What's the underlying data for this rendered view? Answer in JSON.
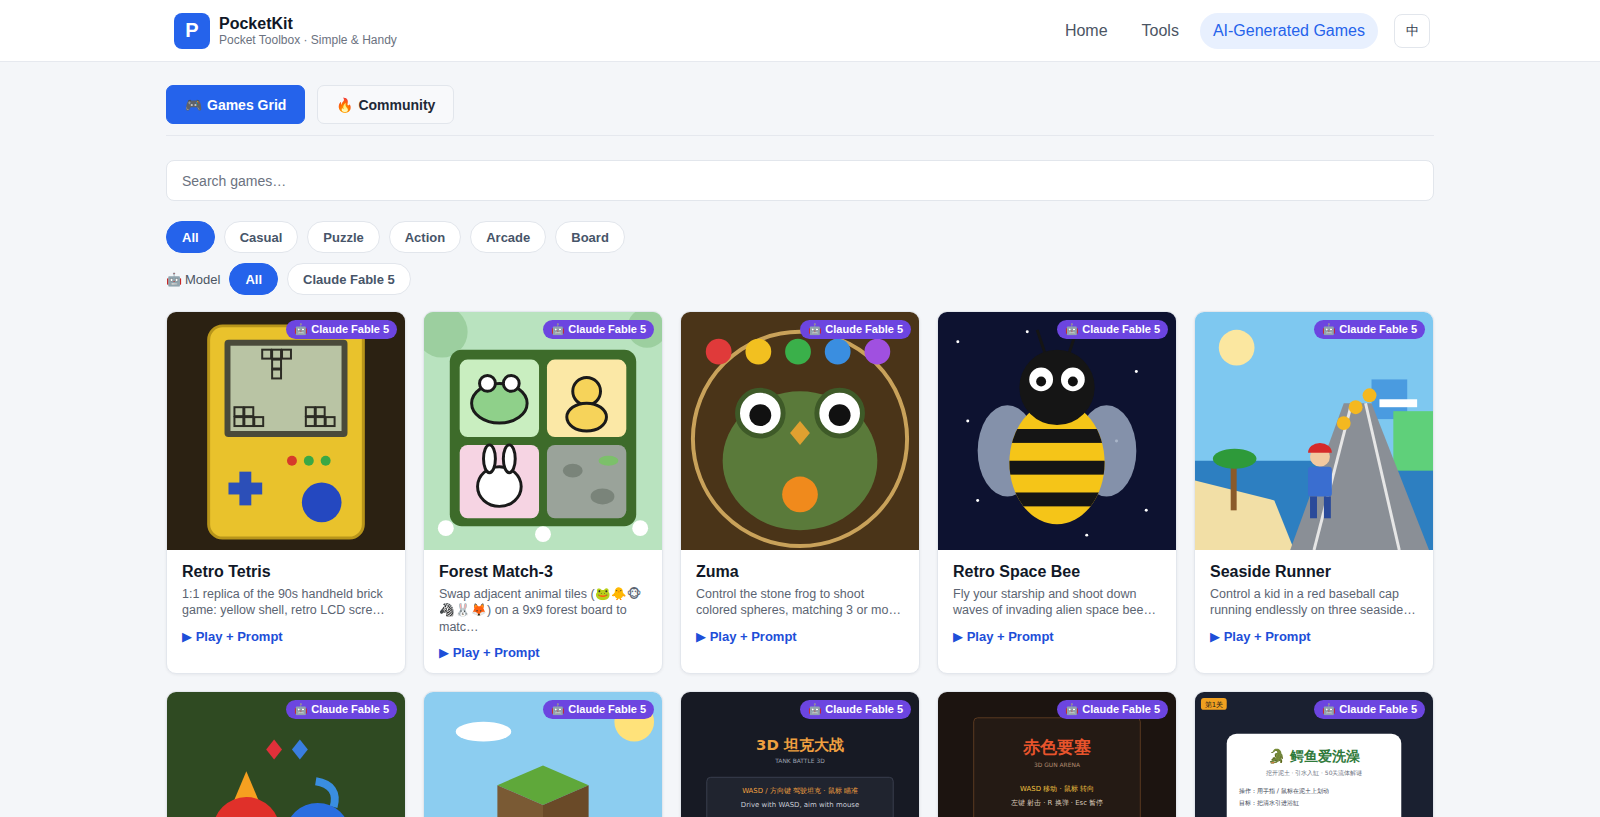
{
  "header": {
    "logo_letter": "P",
    "brand": "PocketKit",
    "tagline": "Pocket Toolbox · Simple & Handy",
    "nav": [
      {
        "label": "Home",
        "selected": false
      },
      {
        "label": "Tools",
        "selected": false
      },
      {
        "label": "AI-Generated Games",
        "selected": true
      }
    ],
    "language_button": "中"
  },
  "view_tabs": [
    {
      "icon": "🎮",
      "label": "Games Grid",
      "selected": true
    },
    {
      "icon": "🔥",
      "label": "Community",
      "selected": false
    }
  ],
  "search": {
    "placeholder": "Search games…"
  },
  "categories": [
    {
      "label": "All",
      "selected": true
    },
    {
      "label": "Casual",
      "selected": false
    },
    {
      "label": "Puzzle",
      "selected": false
    },
    {
      "label": "Action",
      "selected": false
    },
    {
      "label": "Arcade",
      "selected": false
    },
    {
      "label": "Board",
      "selected": false
    }
  ],
  "model_filter": {
    "icon": "🤖",
    "label": "Model",
    "options": [
      {
        "label": "All",
        "selected": true
      },
      {
        "label": "Claude Fable 5",
        "selected": false
      }
    ]
  },
  "games": [
    {
      "kind": "tetris",
      "badge": {
        "icon": "🤖",
        "label": "Claude Fable 5"
      },
      "title": "Retro Tetris",
      "description": "1:1 replica of the 90s handheld brick game: yellow shell, retro LCD scre…",
      "action_icon": "▶",
      "action": "Play + Prompt",
      "thumbnail": {
        "tag": "",
        "texts": []
      }
    },
    {
      "kind": "match3",
      "badge": {
        "icon": "🤖",
        "label": "Claude Fable 5"
      },
      "title": "Forest Match-3",
      "description": "Swap adjacent animal tiles (🐸🐥🐵🦓🐰🦊) on a 9x9 forest board to matc…",
      "action_icon": "▶",
      "action": "Play + Prompt",
      "thumbnail": {
        "tag": "",
        "texts": []
      }
    },
    {
      "kind": "zuma",
      "badge": {
        "icon": "🤖",
        "label": "Claude Fable 5"
      },
      "title": "Zuma",
      "description": "Control the stone frog to shoot colored spheres, matching 3 or mo…",
      "action_icon": "▶",
      "action": "Play + Prompt",
      "thumbnail": {
        "tag": "",
        "texts": []
      }
    },
    {
      "kind": "bee",
      "badge": {
        "icon": "🤖",
        "label": "Claude Fable 5"
      },
      "title": "Retro Space Bee",
      "description": "Fly your starship and shoot down waves of invading alien space bee…",
      "action_icon": "▶",
      "action": "Play + Prompt",
      "thumbnail": {
        "tag": "",
        "texts": []
      }
    },
    {
      "kind": "runner",
      "badge": {
        "icon": "🤖",
        "label": "Claude Fable 5"
      },
      "title": "Seaside Runner",
      "description": "Control a kid in a red baseball cap running endlessly on three seaside…",
      "action_icon": "▶",
      "action": "Play + Prompt",
      "thumbnail": {
        "tag": "",
        "texts": []
      }
    },
    {
      "kind": "firewater",
      "badge": {
        "icon": "🤖",
        "label": "Claude Fable 5"
      },
      "thumbnail": {
        "tag": "",
        "texts": []
      }
    },
    {
      "kind": "blocks",
      "badge": {
        "icon": "🤖",
        "label": "Claude Fable 5"
      },
      "thumbnail": {
        "tag": "",
        "texts": []
      }
    },
    {
      "kind": "tank",
      "badge": {
        "icon": "🤖",
        "label": "Claude Fable 5"
      },
      "thumbnail": {
        "tag": "",
        "texts": [
          "3D 坦克大战",
          "TANK BATTLE 3D",
          "WASD / 方向键 驾驶坦克 · 鼠标 瞄准",
          "Drive with WASD, aim with mouse"
        ]
      }
    },
    {
      "kind": "fortress",
      "badge": {
        "icon": "🤖",
        "label": "Claude Fable 5"
      },
      "thumbnail": {
        "tag": "",
        "texts": [
          "赤色要塞",
          "3D GUN ARENA",
          "WASD 移动 · 鼠标 转向",
          "左键 射击 · R 换弹 · Esc 暂停"
        ]
      }
    },
    {
      "kind": "croc",
      "badge": {
        "icon": "🤖",
        "label": "Claude Fable 5"
      },
      "thumbnail": {
        "tag": "第1关",
        "texts": [
          "🐊 鳄鱼爱洗澡",
          "挖开泥土 · 引水入缸 · 50关流体解谜",
          "操作：用手指 / 鼠标在泥土上划动",
          "目标：把清水引进浴缸"
        ]
      }
    }
  ]
}
